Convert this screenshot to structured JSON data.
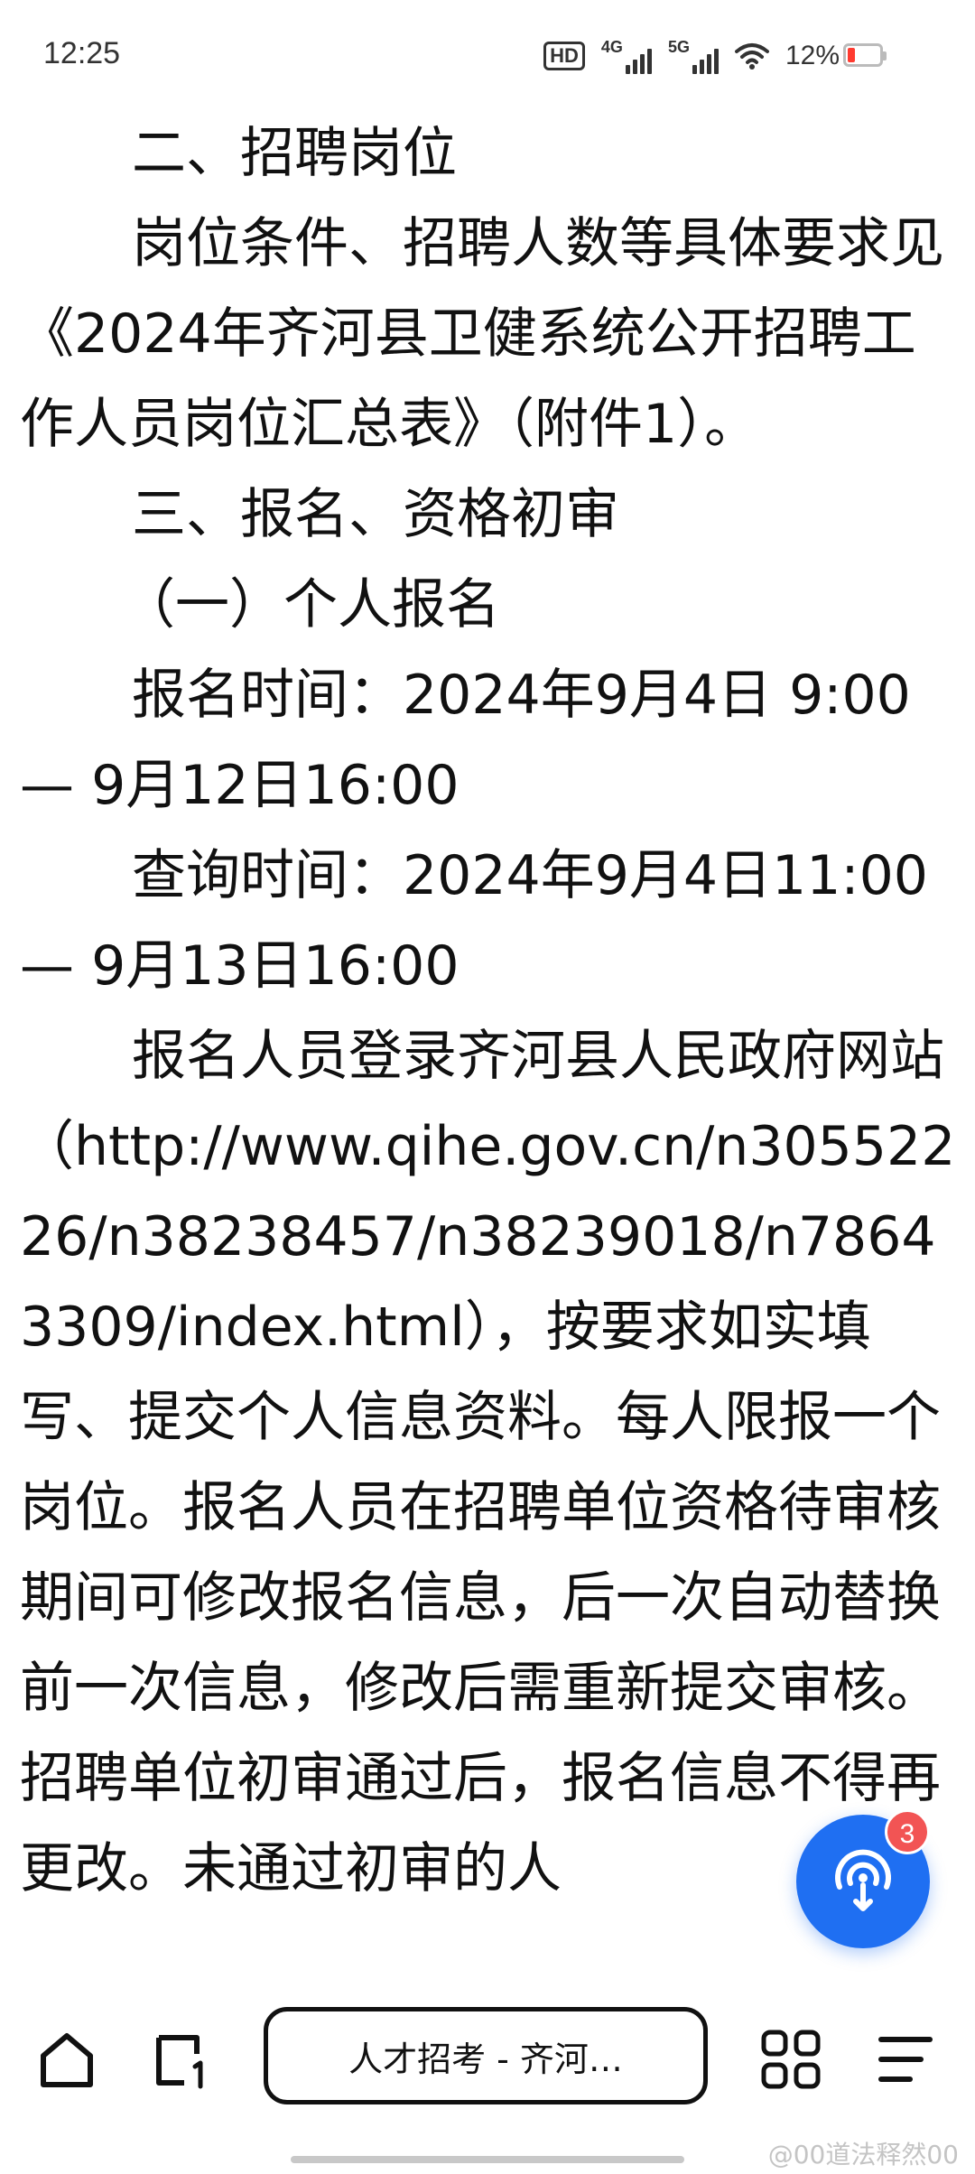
{
  "status_bar": {
    "time": "12:25",
    "hd_label": "HD",
    "net1_label": "4G",
    "net2_label": "5G",
    "battery_percent": "12%"
  },
  "article": {
    "paragraphs": [
      "二、招聘岗位",
      "岗位条件、招聘人数等具体要求见《2024年齐河县卫健系统公开招聘工作人员岗位汇总表》（附件1）。",
      "三、报名、资格初审",
      "（一）个人报名",
      "报名时间：2024年9月4日  9:00— 9月12日16:00",
      "查询时间：2024年9月4日11:00— 9月13日16:00",
      "报名人员登录齐河县人民政府网站（http://www.qihe.gov.cn/n30552226/n38238457/n38239018/n78643309/index.html），按要求如实填写、提交个人信息资料。每人限报一个岗位。报名人员在招聘单位资格待审核期间可修改报名信息，后一次自动替换前一次信息，修改后需重新提交审核。招聘单位初审通过后，报名信息不得再更改。未通过初审的人"
    ]
  },
  "fab": {
    "icon": "broadcast-icon",
    "badge_count": "3",
    "color": "#1f6ff2"
  },
  "bottom_nav": {
    "tab_title": "人才招考 - 齐河…",
    "icons": [
      "home-icon",
      "tabs-icon",
      "grid-icon",
      "menu-icon"
    ]
  },
  "watermark": "@00道法释然00"
}
